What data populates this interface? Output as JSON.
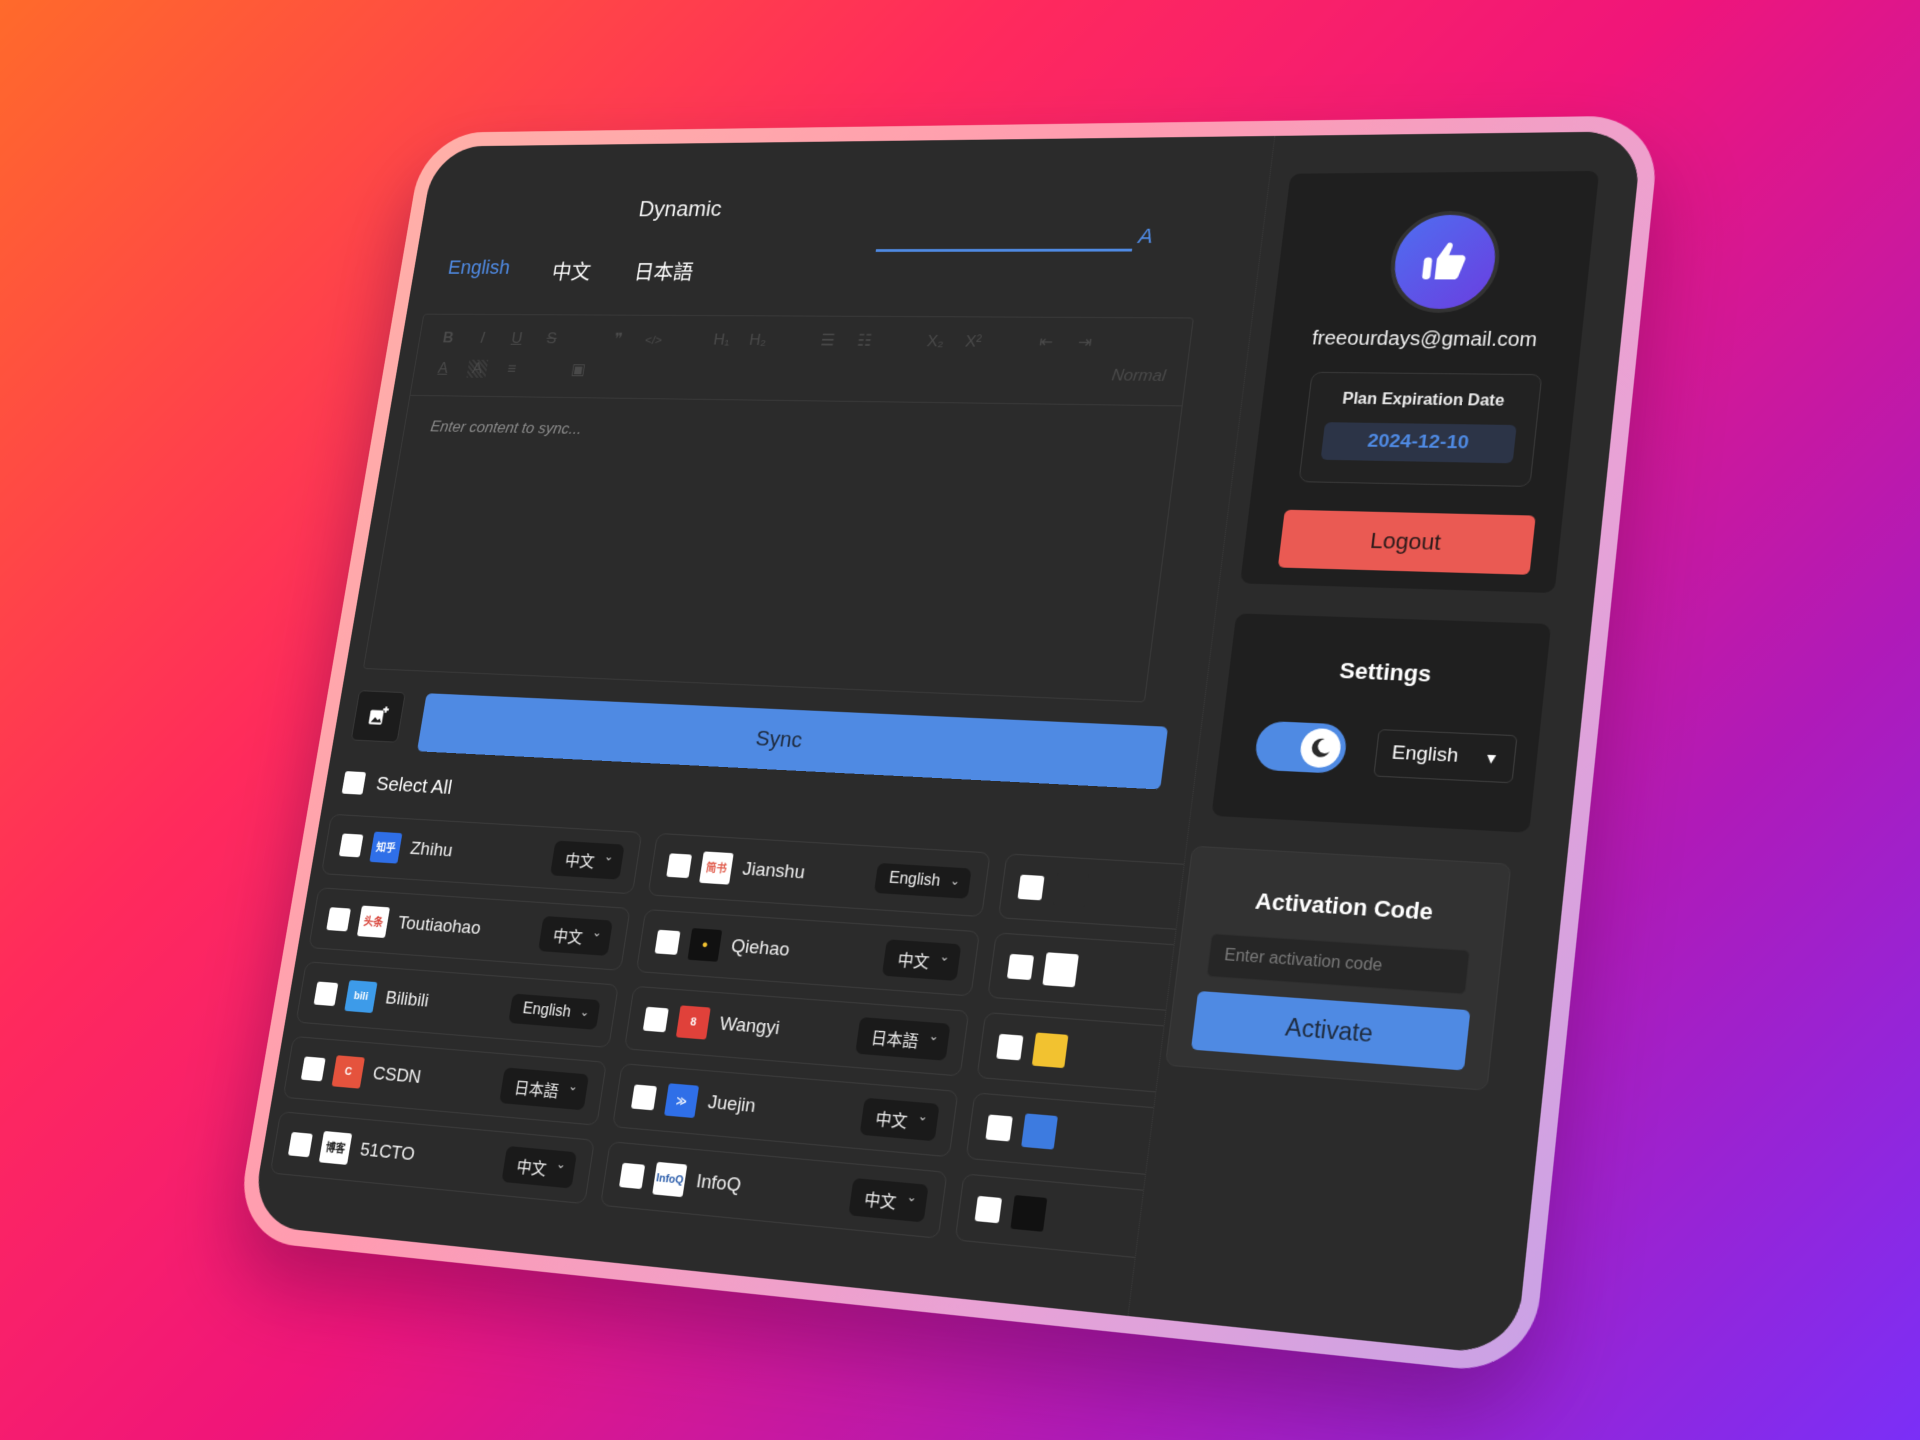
{
  "app": {
    "title": "Dynamic"
  },
  "language_tabs": [
    {
      "label": "English",
      "active": true
    },
    {
      "label": "中文",
      "active": false
    },
    {
      "label": "日本語",
      "active": false
    }
  ],
  "top_tab_partial_label": "A",
  "editor": {
    "toolbar": {
      "row1": [
        "B",
        "I",
        "U",
        "S",
        "❞",
        "</>",
        "H₁",
        "H₂",
        "ordered-list",
        "bullet-list",
        "X₂",
        "X²",
        "outdent",
        "indent"
      ],
      "row2": [
        "A",
        "A",
        "align",
        "image"
      ],
      "format_select": "Normal"
    },
    "placeholder": "Enter content to sync..."
  },
  "actions": {
    "upload_image_icon": "image-add-icon",
    "sync_label": "Sync",
    "select_all_label": "Select All"
  },
  "platforms": [
    {
      "name": "Zhihu",
      "language": "中文",
      "logo_text": "知乎",
      "logo_bg": "#2f6fe8",
      "logo_fg": "#ffffff"
    },
    {
      "name": "Jianshu",
      "language": "English",
      "logo_text": "简书",
      "logo_bg": "#ffffff",
      "logo_fg": "#e05a4a"
    },
    {
      "name": "",
      "language": "",
      "logo_text": "",
      "logo_bg": "#2b2b2b",
      "logo_fg": "#3dae5a"
    },
    {
      "name": "Toutiaohao",
      "language": "中文",
      "logo_text": "头条",
      "logo_bg": "#ffffff",
      "logo_fg": "#d8443a"
    },
    {
      "name": "Qiehao",
      "language": "中文",
      "logo_text": "●",
      "logo_bg": "#111111",
      "logo_fg": "#f2c230"
    },
    {
      "name": "",
      "language": "",
      "logo_text": "",
      "logo_bg": "#ffffff",
      "logo_fg": "#111111"
    },
    {
      "name": "Bilibili",
      "language": "English",
      "logo_text": "bili",
      "logo_bg": "#3d9be9",
      "logo_fg": "#ffffff"
    },
    {
      "name": "Wangyi",
      "language": "日本語",
      "logo_text": "8",
      "logo_bg": "#e0413a",
      "logo_fg": "#ffffff"
    },
    {
      "name": "",
      "language": "",
      "logo_text": "",
      "logo_bg": "#f2c230",
      "logo_fg": "#d8443a"
    },
    {
      "name": "CSDN",
      "language": "日本語",
      "logo_text": "C",
      "logo_bg": "#e5533d",
      "logo_fg": "#ffffff"
    },
    {
      "name": "Juejin",
      "language": "中文",
      "logo_text": "≫",
      "logo_bg": "#2f6fe8",
      "logo_fg": "#ffffff"
    },
    {
      "name": "",
      "language": "",
      "logo_text": "",
      "logo_bg": "#3d7be0",
      "logo_fg": "#ffffff"
    },
    {
      "name": "51CTO",
      "language": "中文",
      "logo_text": "博客",
      "logo_bg": "#ffffff",
      "logo_fg": "#222222"
    },
    {
      "name": "InfoQ",
      "language": "中文",
      "logo_text": "InfoQ",
      "logo_bg": "#ffffff",
      "logo_fg": "#2a5caa"
    },
    {
      "name": "",
      "language": "",
      "logo_text": "",
      "logo_bg": "#111111",
      "logo_fg": "#ffffff"
    }
  ],
  "profile": {
    "avatar_icon": "thumbs-up-icon",
    "email": "freeourdays@gmail.com",
    "plan_label": "Plan Expiration Date",
    "plan_date": "2024-12-10",
    "logout_label": "Logout"
  },
  "settings": {
    "title": "Settings",
    "dark_mode_on": true,
    "language_value": "English"
  },
  "activation": {
    "title": "Activation Code",
    "placeholder": "Enter activation code",
    "value": "",
    "button_label": "Activate"
  },
  "colors": {
    "accent": "#4f8ae3",
    "danger": "#ea5a53",
    "panel": "#1f1f1f",
    "surface": "#2b2b2b"
  }
}
